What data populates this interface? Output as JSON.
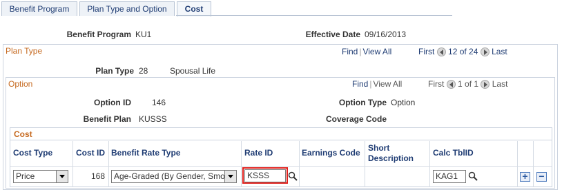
{
  "tabs": [
    "Benefit Program",
    "Plan Type and Option",
    "Cost"
  ],
  "header": {
    "benefit_program_label": "Benefit Program",
    "benefit_program_value": "KU1",
    "effective_date_label": "Effective Date",
    "effective_date_value": "09/16/2013"
  },
  "plan_type": {
    "title": "Plan Type",
    "find": "Find",
    "view_all": "View All",
    "first": "First",
    "counter": "12 of 24",
    "last": "Last",
    "label": "Plan Type",
    "code": "28",
    "desc": "Spousal Life"
  },
  "option": {
    "title": "Option",
    "find": "Find",
    "view_all": "View All",
    "first": "First",
    "counter": "1 of 1",
    "last": "Last",
    "option_id_label": "Option ID",
    "option_id_value": "146",
    "option_type_label": "Option Type",
    "option_type_value": "Option",
    "benefit_plan_label": "Benefit Plan",
    "benefit_plan_value": "KUSSS",
    "coverage_code_label": "Coverage Code",
    "coverage_code_value": ""
  },
  "cost": {
    "title": "Cost",
    "columns": [
      "Cost Type",
      "Cost ID",
      "Benefit Rate Type",
      "Rate ID",
      "Earnings Code",
      "Short Description",
      "Calc TblID"
    ],
    "row": {
      "cost_type": "Price",
      "cost_id": "168",
      "benefit_rate_type": "Age-Graded (By Gender, Smoker)",
      "rate_id": "KSSS",
      "earnings_code": "",
      "short_description": "",
      "calc_tblid": "KAG1"
    },
    "add_label": "+",
    "delete_label": "−"
  },
  "colors": {
    "accent_orange": "#c66a20",
    "link_blue": "#1f3c73",
    "highlight_red": "#e0201c"
  }
}
